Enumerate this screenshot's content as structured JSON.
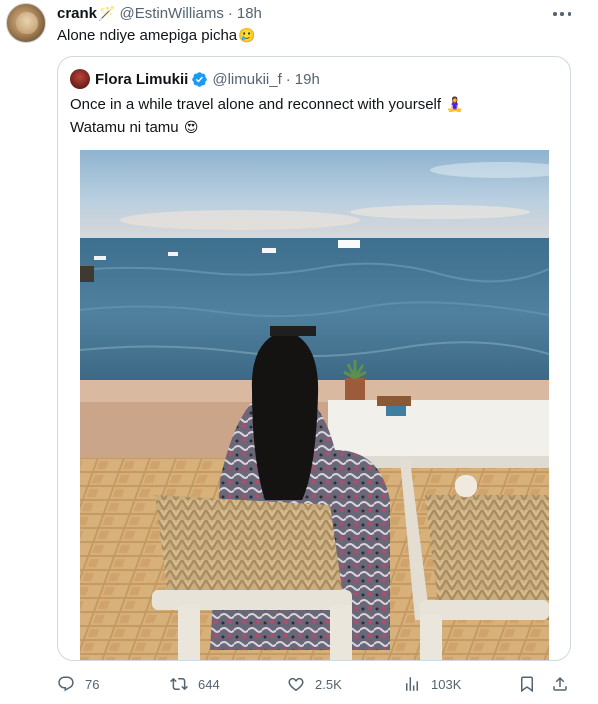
{
  "tweet": {
    "author_name": "crank",
    "author_handle": "@EstinWilliams",
    "separator": "·",
    "time": "18h",
    "text": "Alone ndiye amepiga picha",
    "text_emoji": "🥲"
  },
  "quoted": {
    "author_name": "Flora Limukii",
    "author_handle": "@limukii_f",
    "separator": "·",
    "time": "19h",
    "line1": "Once in a while travel alone and reconnect with yourself",
    "line1_emoji": "🧘‍♀️",
    "line2": "Watamu ni tamu",
    "line2_emoji": "😍"
  },
  "actions": {
    "replies": "76",
    "reposts": "644",
    "likes": "2.5K",
    "views": "103K"
  },
  "colors": {
    "text": "#0f1419",
    "muted": "#536471",
    "border": "#cfd9de",
    "verified": "#1d9bf0"
  }
}
